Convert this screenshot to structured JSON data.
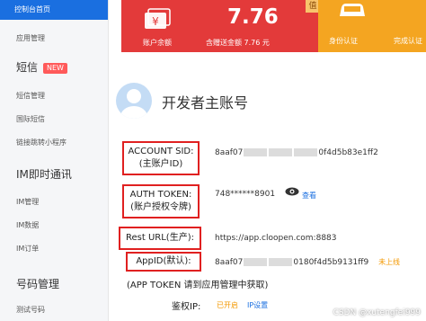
{
  "sidebar": {
    "active": "控制台首页",
    "items": [
      {
        "label": "应用管理"
      },
      {
        "section": "短信",
        "badge": "NEW"
      },
      {
        "label": "短信管理"
      },
      {
        "label": "国际短信"
      },
      {
        "label": "链接跳转小程序"
      },
      {
        "section": "IM即时通讯"
      },
      {
        "label": "IM管理"
      },
      {
        "label": "IM数据"
      },
      {
        "label": "IM订单"
      },
      {
        "section": "号码管理"
      },
      {
        "label": "测试号码"
      }
    ]
  },
  "balance_card": {
    "corner": "值",
    "amount": "7.76",
    "balance_label": "账户余额",
    "includes_label": "含赠送金额 7.76 元"
  },
  "cert_card": {
    "id_label": "身份认证",
    "done_label": "完成认证"
  },
  "developer": {
    "title": "开发者主账号",
    "fields": [
      {
        "label": "ACCOUNT SID:\n(主账户ID)",
        "value_pre": "8aaf07",
        "value_post": "0f4d5b83e1ff2"
      },
      {
        "label": "AUTH TOKEN:\n(账户授权令牌)",
        "value": "748******8901",
        "action": "查看"
      },
      {
        "label": "Rest URL(生产):",
        "value": "https://app.cloopen.com:8883"
      },
      {
        "label": "AppID(默认):",
        "value_pre": "8aaf07",
        "value_post": "0180f4d5b9131ff9",
        "status": "未上线"
      }
    ],
    "app_token_note": "(APP TOKEN 请到应用管理中获取)",
    "ip_label": "鉴权IP:",
    "ip_status": "已开启",
    "ip_link": "IP设置"
  },
  "watermark": "CSDN @xutengfei999",
  "colors": {
    "primary": "#1a6fe0",
    "red": "#e33a3a",
    "yellow": "#f4a521",
    "highlight": "#e02020"
  }
}
